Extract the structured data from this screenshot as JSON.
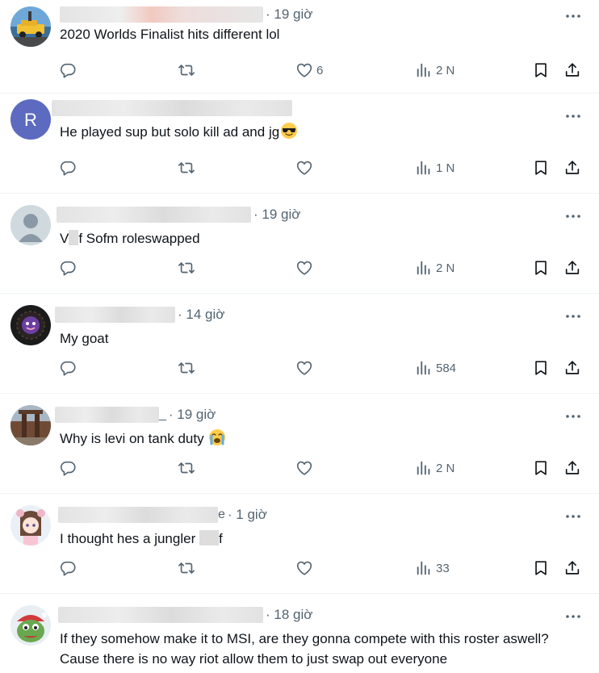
{
  "posts": [
    {
      "frag": "",
      "time": "· 19 giờ",
      "text": "2020 Worlds Finalist hits different lol",
      "emoji": "",
      "likes": "6",
      "views": "2 N",
      "avatar": "car-avatar"
    },
    {
      "frag": "",
      "time": "",
      "text": "He played sup but solo kill ad and jg",
      "emoji": "sunglasses-emoji",
      "likes": "",
      "views": "1 N",
      "avatar": "letter-avatar",
      "avatar_letter": "R"
    },
    {
      "frag": "",
      "time": "· 19 giờ",
      "text_before": "V",
      "text_after": "f Sofm roleswapped",
      "likes": "",
      "views": "2 N",
      "avatar": "default-avatar"
    },
    {
      "frag": "",
      "time": "· 14 giờ",
      "text": "My goat",
      "likes": "",
      "views": "584",
      "avatar": "dark-face-avatar"
    },
    {
      "frag": "_",
      "time": "· 19 giờ",
      "text": "Why is levi on tank duty",
      "emoji": "crying-emoji",
      "likes": "",
      "views": "2 N",
      "avatar": "photo-avatar"
    },
    {
      "frag": "e",
      "time": "· 1 giờ",
      "text_before": "I thought hes a jungler ",
      "text_after": "f",
      "likes": "",
      "views": "33",
      "avatar": "anime-avatar"
    },
    {
      "frag": "",
      "time": "· 18 giờ",
      "text": "If they somehow make it to MSI, are they gonna compete with this roster aswell? Cause there is no way riot allow them to just swap out everyone",
      "avatar": "pepe-avatar"
    }
  ],
  "icons": {
    "more": "more-icon",
    "reply": "reply-icon",
    "retweet": "retweet-icon",
    "like": "heart-icon",
    "views": "views-icon",
    "bookmark": "bookmark-icon",
    "share": "share-icon"
  },
  "colors": {
    "text": "#0f1419",
    "secondary": "#536471",
    "divider": "#eff3f4",
    "letter_avatar": "#5c6bc0"
  }
}
